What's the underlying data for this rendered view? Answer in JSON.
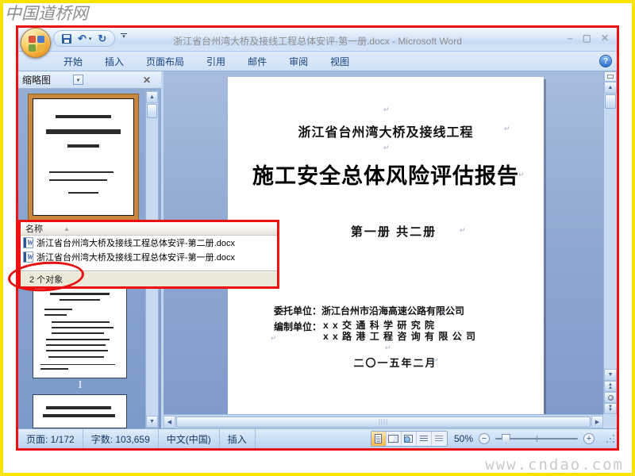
{
  "watermark": {
    "top_left": "中国道桥网",
    "bottom_right": "www.cndao.com"
  },
  "titlebar": {
    "title": "浙江省台州湾大桥及接线工程总体安评-第一册.docx - Microsoft Word",
    "minimize": "–",
    "maximize": "▢",
    "close": "✕",
    "undo_glyph": "↶",
    "redo_glyph": "↻",
    "dropdown_glyph": "▾"
  },
  "ribbon": {
    "tabs": [
      "开始",
      "插入",
      "页面布局",
      "引用",
      "邮件",
      "审阅",
      "视图"
    ],
    "help": "?"
  },
  "thumbnail_pane": {
    "title": "缩略图",
    "dropdown_glyph": "▾",
    "close_glyph": "✕",
    "page_label": "I",
    "scroll_up": "▲",
    "scroll_down": "▼"
  },
  "popup": {
    "column_header": "名称",
    "sort_arrow": "▲",
    "files": [
      "浙江省台州湾大桥及接线工程总体安评-第二册.docx",
      "浙江省台州湾大桥及接线工程总体安评-第一册.docx"
    ],
    "status": "2 个对象"
  },
  "document": {
    "subtitle": "浙江省台州湾大桥及接线工程",
    "title": "施工安全总体风险评估报告",
    "volume": "第一册  共二册",
    "client_label": "委托单位：",
    "client": "浙江台州市沿海高速公路有限公司",
    "compiler_label": "编制单位：",
    "compiler_line1": "x x  交 通 科 学 研 究 院",
    "compiler_line2": "x x 路 港 工 程 咨 询 有 限 公 司",
    "date": "二〇一五年二月",
    "pilcrow": "↵"
  },
  "scroll": {
    "up": "▲",
    "down": "▼",
    "left": "◀",
    "right": "▶",
    "thumb_grip": "||||"
  },
  "status_bar": {
    "page": "页面: 1/172",
    "words": "字数: 103,659",
    "language": "中文(中国)",
    "insert_mode": "插入",
    "zoom_level": "50%",
    "zoom_out": "−",
    "zoom_in": "+"
  },
  "colors": {
    "annotation_red": "#ec1212",
    "frame_yellow": "#f6e300",
    "active_view_orange": "#f9cb74",
    "theme_blue": "#8aa6d1"
  }
}
